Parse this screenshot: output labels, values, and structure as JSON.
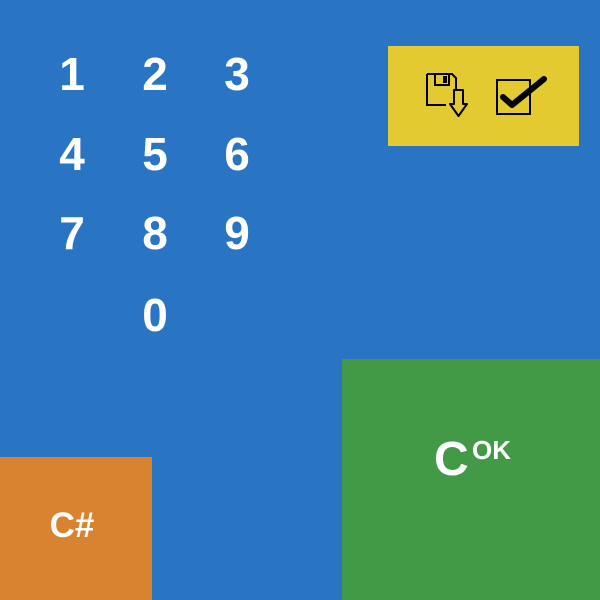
{
  "keypad": {
    "k1": "1",
    "k2": "2",
    "k3": "3",
    "k4": "4",
    "k5": "5",
    "k6": "6",
    "k7": "7",
    "k8": "8",
    "k9": "9",
    "k0": "0"
  },
  "toolbar": {
    "save_icon": "save-download-icon",
    "confirm_icon": "checkbox-check-icon"
  },
  "ok_panel": {
    "letter": "C",
    "label": "OK"
  },
  "clear_panel": {
    "label": "C#"
  },
  "colors": {
    "background": "#2a74c4",
    "toolbar": "#e3ca31",
    "ok_panel": "#429a47",
    "clear_panel": "#d98230",
    "text": "#ffffff"
  }
}
